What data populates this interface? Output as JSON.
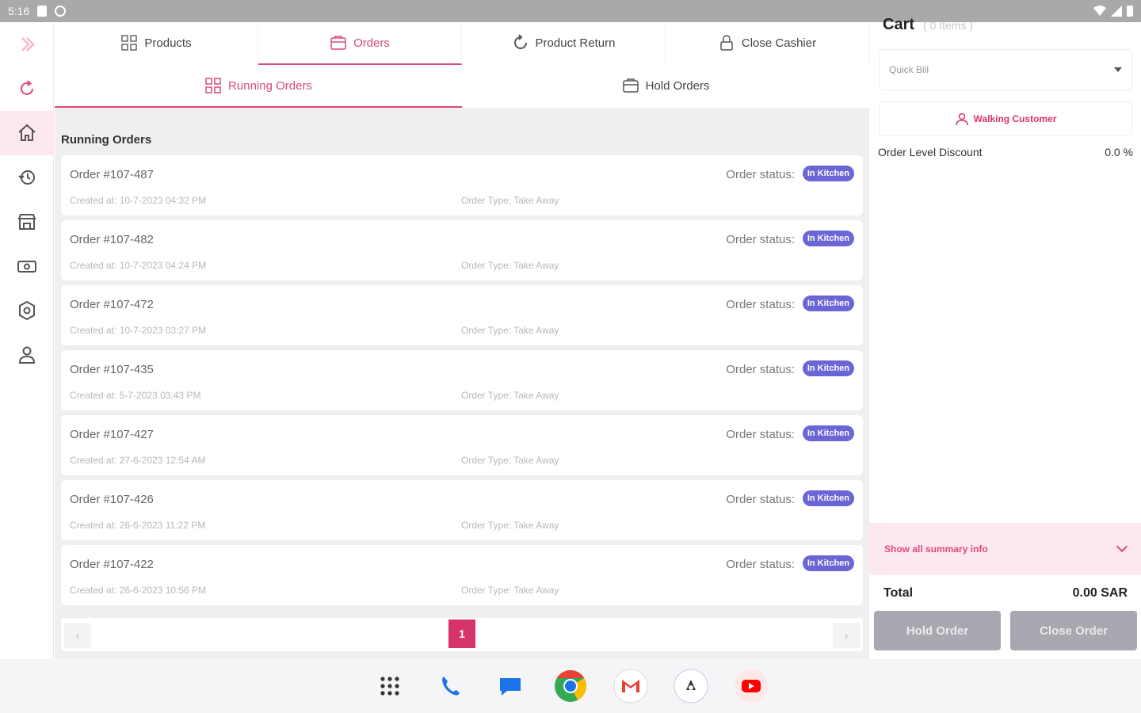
{
  "status_bar": {
    "time": "5:16"
  },
  "rail": {
    "items": [
      {
        "name": "expand-icon"
      },
      {
        "name": "refresh-icon"
      },
      {
        "name": "home-icon",
        "active": true
      },
      {
        "name": "history-icon"
      },
      {
        "name": "store-icon"
      },
      {
        "name": "cash-icon"
      },
      {
        "name": "settings-icon"
      },
      {
        "name": "user-icon"
      }
    ]
  },
  "tabs": [
    {
      "label": "Products",
      "icon": "grid-icon"
    },
    {
      "label": "Orders",
      "icon": "orders-icon",
      "active": true
    },
    {
      "label": "Product Return",
      "icon": "return-icon"
    },
    {
      "label": "Close Cashier",
      "icon": "lock-icon"
    }
  ],
  "subtabs": [
    {
      "label": "Running Orders",
      "icon": "grid-icon",
      "active": true
    },
    {
      "label": "Hold Orders",
      "icon": "hold-icon"
    }
  ],
  "section_title": "Running Orders",
  "order_status_label": "Order status:",
  "orders": [
    {
      "number": "Order #107-487",
      "created": "Created at: 10-7-2023 04:32 PM",
      "type": "Order Type: Take Away",
      "status": "In Kitchen"
    },
    {
      "number": "Order #107-482",
      "created": "Created at: 10-7-2023 04:24 PM",
      "type": "Order Type: Take Away",
      "status": "In Kitchen"
    },
    {
      "number": "Order #107-472",
      "created": "Created at: 10-7-2023 03:27 PM",
      "type": "Order Type: Take Away",
      "status": "In Kitchen"
    },
    {
      "number": "Order #107-435",
      "created": "Created at: 5-7-2023 03:43 PM",
      "type": "Order Type: Take Away",
      "status": "In Kitchen"
    },
    {
      "number": "Order #107-427",
      "created": "Created at: 27-6-2023 12:54 AM",
      "type": "Order Type: Take Away",
      "status": "In Kitchen"
    },
    {
      "number": "Order #107-426",
      "created": "Created at: 26-6-2023 11:22 PM",
      "type": "Order Type: Take Away",
      "status": "In Kitchen"
    },
    {
      "number": "Order #107-422",
      "created": "Created at: 26-6-2023 10:56 PM",
      "type": "Order Type: Take Away",
      "status": "In Kitchen"
    }
  ],
  "pager": {
    "prev": "‹",
    "current": "1",
    "next": "›"
  },
  "cart": {
    "title": "Cart",
    "count": "( 0 Items )",
    "customer_select": "Quick Bill",
    "walkin": "Walking Customer",
    "discount_label": "Order Level Discount",
    "discount_value": "0.0 %",
    "summary": "Show all summary info",
    "total_label": "Total",
    "total_value": "0.00 SAR",
    "hold_button": "Hold Order",
    "close_button": "Close Order"
  },
  "colors": {
    "accent": "#d6336c",
    "badge": "#6b66d6",
    "disabled_button": "#a9a8b0"
  },
  "dock": [
    "apps-icon",
    "phone-icon",
    "messages-icon",
    "chrome-icon",
    "gmail-icon",
    "pos-app-icon",
    "youtube-icon"
  ]
}
